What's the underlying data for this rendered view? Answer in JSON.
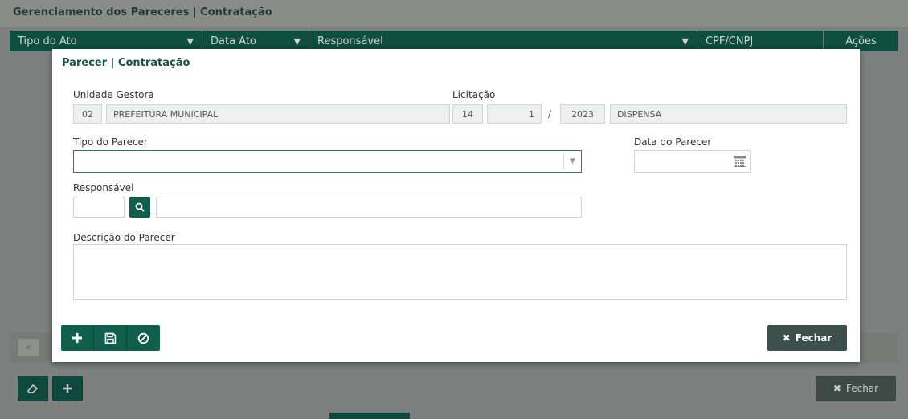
{
  "background": {
    "title": "Gerenciamento dos Pareceres | Contratação",
    "grid_columns": [
      "Tipo do Ato",
      "Data Ato",
      "Responsável",
      "CPF/CNPJ",
      "Ações"
    ],
    "footer_close_label": "Fechar"
  },
  "modal": {
    "title": "Parecer | Contratação",
    "unidade_gestora": {
      "label": "Unidade Gestora",
      "code": "02",
      "name": "PREFEITURA MUNICIPAL"
    },
    "licitacao": {
      "label": "Licitação",
      "field1": "14",
      "field2": "1",
      "separator": "/",
      "year": "2023",
      "type": "DISPENSA"
    },
    "tipo_parecer": {
      "label": "Tipo do Parecer",
      "value": ""
    },
    "data_parecer": {
      "label": "Data do Parecer",
      "value": ""
    },
    "responsavel": {
      "label": "Responsável",
      "code": "",
      "name": ""
    },
    "descricao": {
      "label": "Descrição do Parecer",
      "value": ""
    },
    "close_label": "Fechar"
  },
  "colors": {
    "primary": "#0f5f4c",
    "grid_header": "#0f4f42",
    "close_button": "#3c4f4a"
  }
}
